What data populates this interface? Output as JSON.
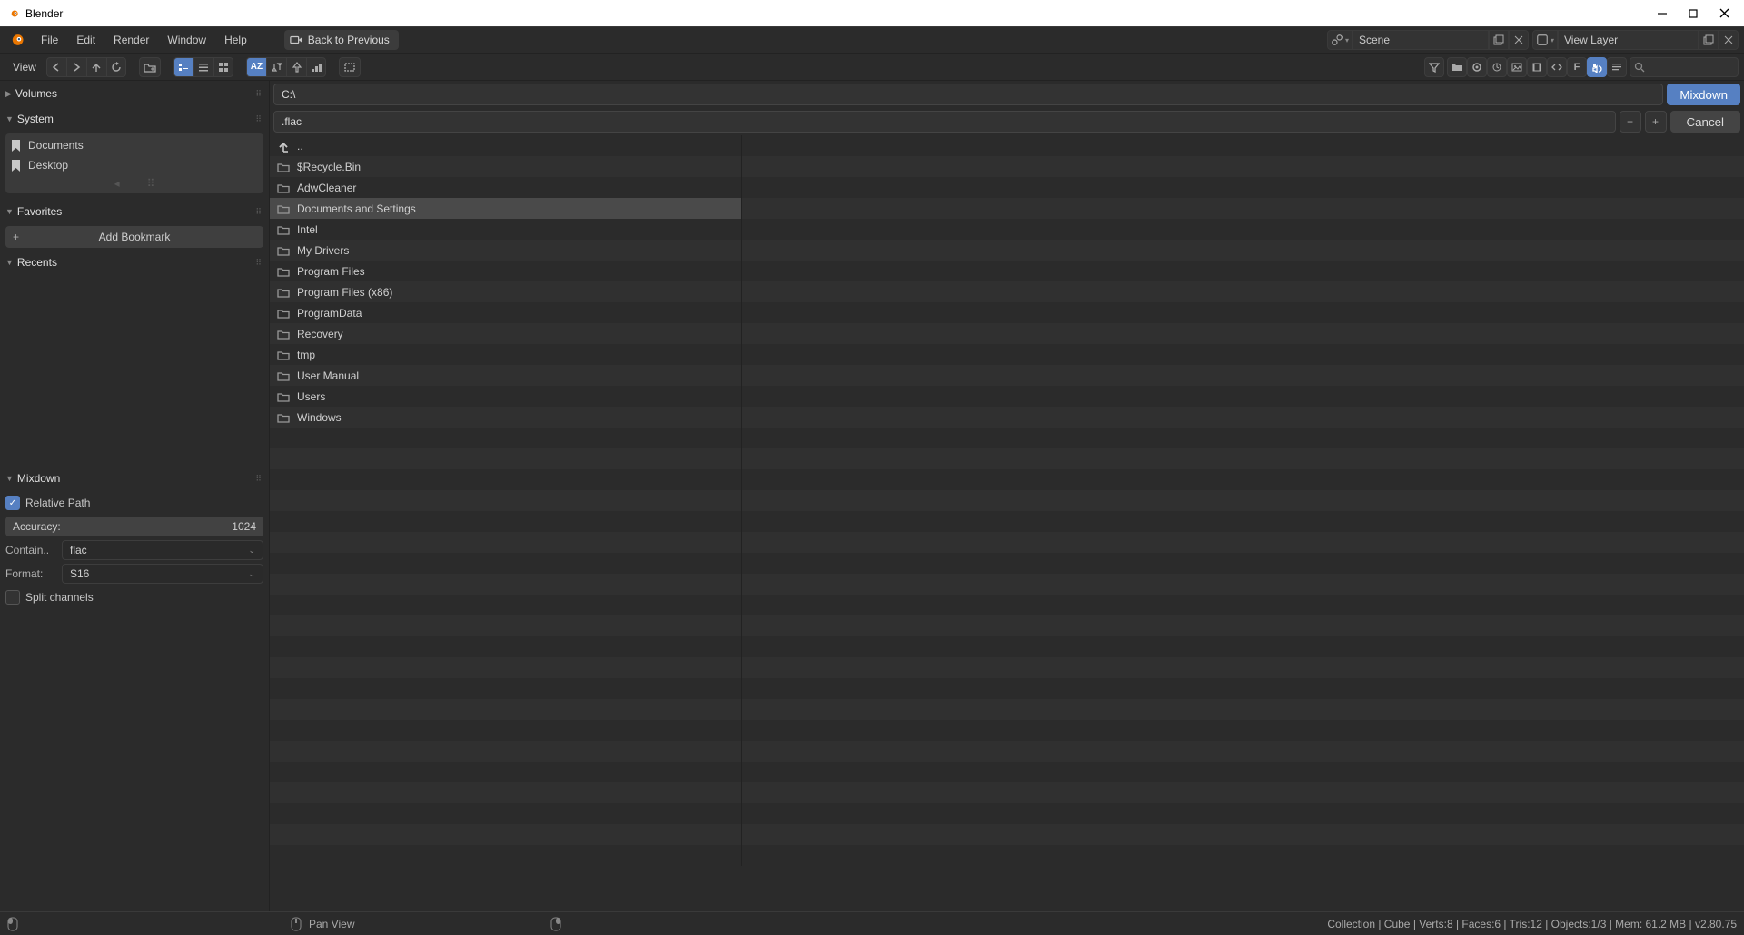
{
  "title": "Blender",
  "menubar": {
    "items": [
      "File",
      "Edit",
      "Render",
      "Window",
      "Help"
    ],
    "back_to_previous": "Back to Previous",
    "scene_label": "Scene",
    "layer_label": "View Layer"
  },
  "toolbar": {
    "view_label": "View"
  },
  "sidebar": {
    "volumes_header": "Volumes",
    "system_header": "System",
    "system_items": [
      "Documents",
      "Desktop"
    ],
    "favorites_header": "Favorites",
    "add_bookmark": "Add Bookmark",
    "recents_header": "Recents",
    "mixdown_header": "Mixdown",
    "relative_path": "Relative Path",
    "accuracy_label": "Accuracy:",
    "accuracy_value": "1024",
    "container_label": "Contain..",
    "container_value": "flac",
    "format_label": "Format:",
    "format_value": "S16",
    "split_channels": "Split channels"
  },
  "path_bar": {
    "path": "C:\\",
    "mixdown_btn": "Mixdown",
    "filename": ".flac",
    "cancel_btn": "Cancel"
  },
  "file_list": {
    "parent": "..",
    "entries": [
      {
        "name": "$Recycle.Bin",
        "type": "folder"
      },
      {
        "name": "AdwCleaner",
        "type": "folder"
      },
      {
        "name": "Documents and Settings",
        "type": "folder",
        "selected": true
      },
      {
        "name": "Intel",
        "type": "folder"
      },
      {
        "name": "My Drivers",
        "type": "folder"
      },
      {
        "name": "Program Files",
        "type": "folder"
      },
      {
        "name": "Program Files (x86)",
        "type": "folder"
      },
      {
        "name": "ProgramData",
        "type": "folder"
      },
      {
        "name": "Recovery",
        "type": "folder"
      },
      {
        "name": "tmp",
        "type": "folder"
      },
      {
        "name": "User Manual",
        "type": "folder"
      },
      {
        "name": "Users",
        "type": "folder"
      },
      {
        "name": "Windows",
        "type": "folder"
      }
    ]
  },
  "statusbar": {
    "pan_view": "Pan View",
    "stats": "Collection | Cube | Verts:8 | Faces:6 | Tris:12 | Objects:1/3 | Mem: 61.2 MB | v2.80.75"
  }
}
